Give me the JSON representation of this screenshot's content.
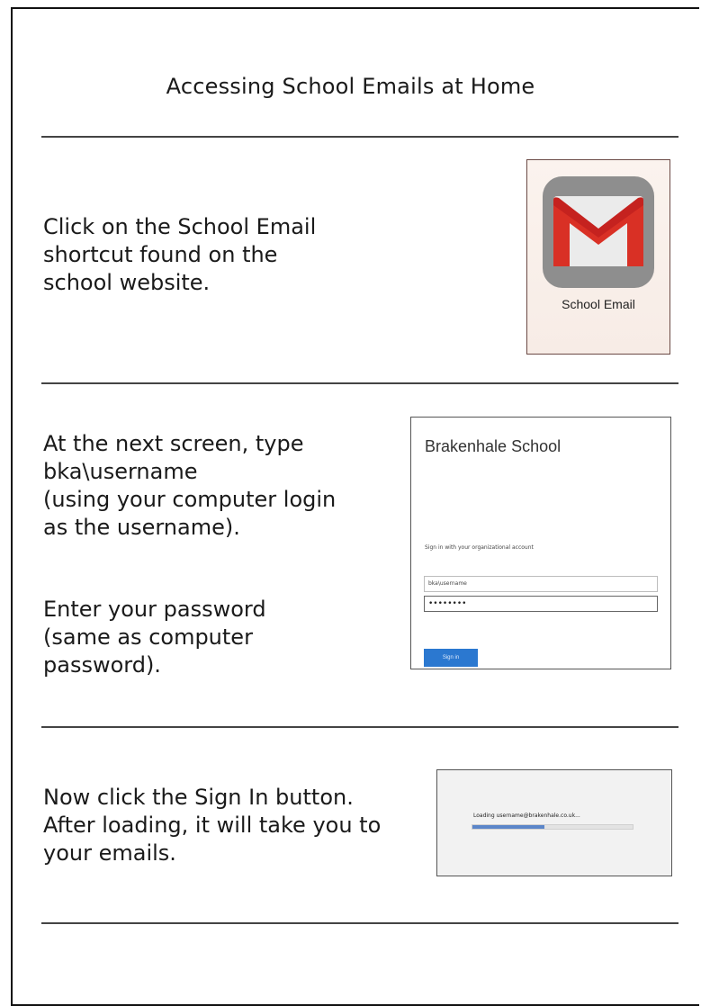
{
  "title": "Accessing School Emails at Home",
  "step1": {
    "lines": [
      "Click on the School Email",
      "shortcut found on the",
      "school website."
    ],
    "shortcut_label": "School Email",
    "icon": "gmail-icon",
    "colors": {
      "gmail_red": "#d93025",
      "tile": "#8e8e8e"
    }
  },
  "step2": {
    "lines": [
      "At the next screen, type",
      "bka\\username",
      "(using your computer login",
      "as the username)."
    ],
    "lines2": [
      "Enter your password",
      "(same as computer",
      "password)."
    ],
    "screenshot": {
      "org_name": "Brakenhale School",
      "prompt": "Sign in with your organizational account",
      "username_value": "bka\\username",
      "password_value": "••••••••",
      "button_label": "Sign in"
    }
  },
  "step3": {
    "lines": [
      "Now click the Sign In button.",
      "After loading, it will take you to",
      "your emails."
    ],
    "screenshot": {
      "loading_text": "Loading username@brakenhale.co.uk...",
      "progress": 0.45
    }
  }
}
